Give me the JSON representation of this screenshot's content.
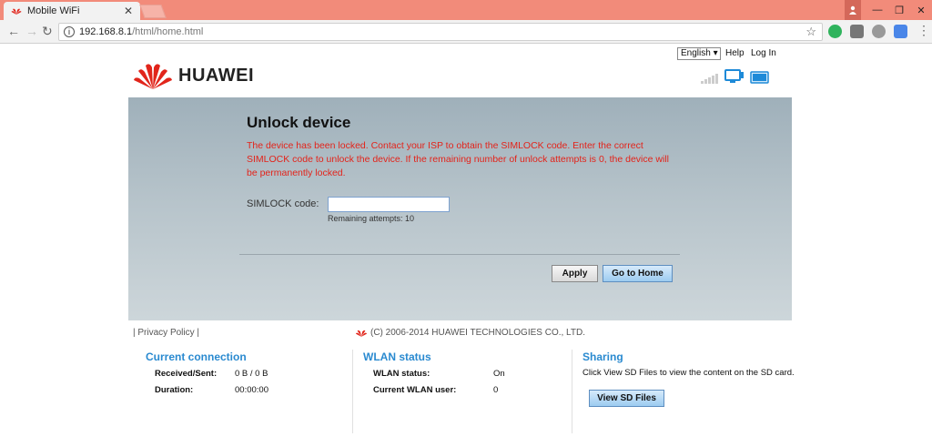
{
  "browser": {
    "tab_title": "Mobile WiFi",
    "url_host": "192.168.8.1",
    "url_path": "/html/home.html"
  },
  "header": {
    "brand": "HUAWEI",
    "language": "English",
    "help": "Help",
    "login": "Log In"
  },
  "unlock": {
    "title": "Unlock device",
    "message": "The device has been locked. Contact your ISP to obtain the SIMLOCK code. Enter the correct SIMLOCK code to unlock the device. If the remaining number of unlock attempts is 0, the device will be permanently locked.",
    "code_label": "SIMLOCK code:",
    "code_value": "",
    "remaining": "Remaining attempts:  10",
    "apply": "Apply",
    "go_home": "Go to Home"
  },
  "footer": {
    "privacy": "| Privacy Policy |",
    "copyright": "(C) 2006-2014 HUAWEI TECHNOLOGIES CO., LTD."
  },
  "current_connection": {
    "title": "Current connection",
    "received_sent_label": "Received/Sent:",
    "received_sent_value": "0 B /  0 B",
    "duration_label": "Duration:",
    "duration_value": "00:00:00"
  },
  "wlan": {
    "title": "WLAN status",
    "status_label": "WLAN status:",
    "status_value": "On",
    "users_label": "Current WLAN user:",
    "users_value": "0"
  },
  "sharing": {
    "title": "Sharing",
    "description": "Click View SD Files to view the content on the SD card.",
    "button": "View SD Files"
  },
  "colors": {
    "accent_blue": "#2a8ad0",
    "warning_red": "#e3231a",
    "titlebar": "#f28b7a"
  }
}
